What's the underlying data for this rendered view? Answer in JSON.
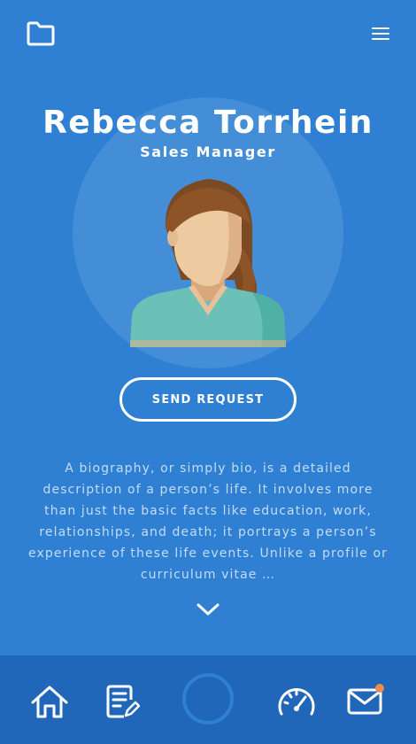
{
  "header": {
    "folder_icon": "folder-icon",
    "menu_icon": "hamburger-menu-icon"
  },
  "profile": {
    "name": "Rebecca Torrhein",
    "role": "Sales Manager",
    "avatar": "woman-avatar-illustration"
  },
  "actions": {
    "send_request_label": "SEND REQUEST"
  },
  "bio": {
    "text": "A biography, or simply bio, is a detailed description of a person’s life. It involves more than just the basic facts like education, work, relationships, and death; it portrays a person’s experience of these life events. Unlike a profile or curriculum vitae …",
    "expand_icon": "chevron-down-icon"
  },
  "bottom_nav": {
    "items": [
      {
        "icon": "home-icon"
      },
      {
        "icon": "notes-edit-icon"
      },
      {
        "icon": "circle-center-button"
      },
      {
        "icon": "speedometer-icon"
      },
      {
        "icon": "mail-icon",
        "has_notification": true
      }
    ]
  },
  "colors": {
    "background": "#2f80d3",
    "bottom_nav": "#2067ba",
    "notification_dot": "#ef8b4c",
    "text_white": "#ffffff",
    "bio_text": "#c3dcf5"
  }
}
